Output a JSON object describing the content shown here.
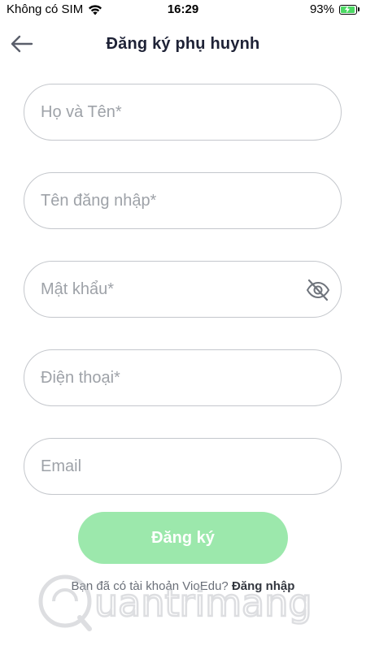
{
  "status_bar": {
    "carrier": "Không có SIM",
    "time": "16:29",
    "battery_percent": "93%",
    "battery_level": 0.93
  },
  "header": {
    "title": "Đăng ký phụ huynh",
    "back_icon": "arrow-left-icon"
  },
  "form": {
    "full_name_placeholder": "Họ và Tên*",
    "username_placeholder": "Tên đăng nhập*",
    "password_placeholder": "Mật khẩu*",
    "phone_placeholder": "Điện thoại*",
    "email_placeholder": "Email",
    "password_toggle_icon": "eye-off-icon"
  },
  "actions": {
    "register_label": "Đăng ký",
    "have_account_text": "Bạn đã có tài khoản VioEdu?",
    "login_label": "Đăng nhập"
  },
  "watermark": {
    "text": "uantrimang"
  },
  "colors": {
    "register_button": "#9ce8ac",
    "field_border": "#c4c7cc",
    "title": "#1e2236"
  }
}
